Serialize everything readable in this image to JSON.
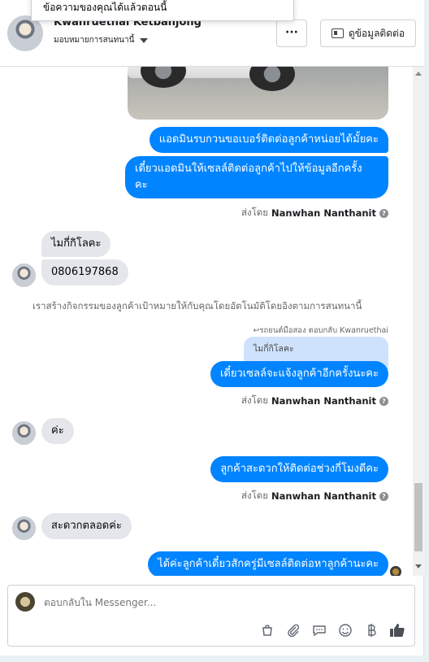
{
  "tooltip": {
    "text": "ข้อความของคุณได้แล้วตอนนี้"
  },
  "header": {
    "name": "Kwanruethai Ketbanjong",
    "subtitle": "มอบหมายการสนทนานี้",
    "contact_label": "ดูข้อมูลติดต่อ"
  },
  "messages": {
    "m1": "แอดมินรบกวนขอเบอร์ติดต่อลูกค้าหน่อยได้มั้ยคะ",
    "m2a": "เดี๋ยวแอดมินให้เซลล์ติดต่อลูกค้าไปให้ข้อมูลอีกครั้ง",
    "m2b": "คะ",
    "sent1_prefix": "ส่งโดย",
    "sent1_name": "Nanwhan Nanthanit",
    "in1": "ไมกี่กิโลคะ",
    "in2": "0806197868",
    "notice": "เราสร้างกิจกรรมของลูกค้าเป้าหมายให้กับคุณโดยอัตโนมัติโดยอิงตามการสนทนานี้",
    "reply_meta": "↩รถยนต์มือสอง ตอบกลับ Kwanruethai",
    "quoted": "ไมกี่กิโลคะ",
    "m3": "เดี๋ยวเซลล์จะแจ้งลูกค้าอีกครั้งนะคะ",
    "sent2_prefix": "ส่งโดย",
    "sent2_name": "Nanwhan Nanthanit",
    "in3": "ค่ะ",
    "m4": "ลูกค้าสะดวกให้ติดต่อช่วงกี่โมงดีคะ",
    "sent3_prefix": "ส่งโดย",
    "sent3_name": "Nanwhan Nanthanit",
    "in4": "สะดวกตลอดค่ะ",
    "m5": "ได้ค่ะลูกค้าเดี๋ยวสักครู่มีเซลล์ติดต่อหาลูกค้านะคะ"
  },
  "composer": {
    "placeholder": "ตอบกลับใน Messenger...",
    "tools": [
      "shopping-bag-icon",
      "attachment-icon",
      "chat-bubble-icon",
      "emoji-icon",
      "baht-icon",
      "thumbs-up-icon"
    ]
  },
  "colors": {
    "outgoing": "#0084ff",
    "incoming": "#e4e6eb",
    "muted": "#65676b"
  }
}
